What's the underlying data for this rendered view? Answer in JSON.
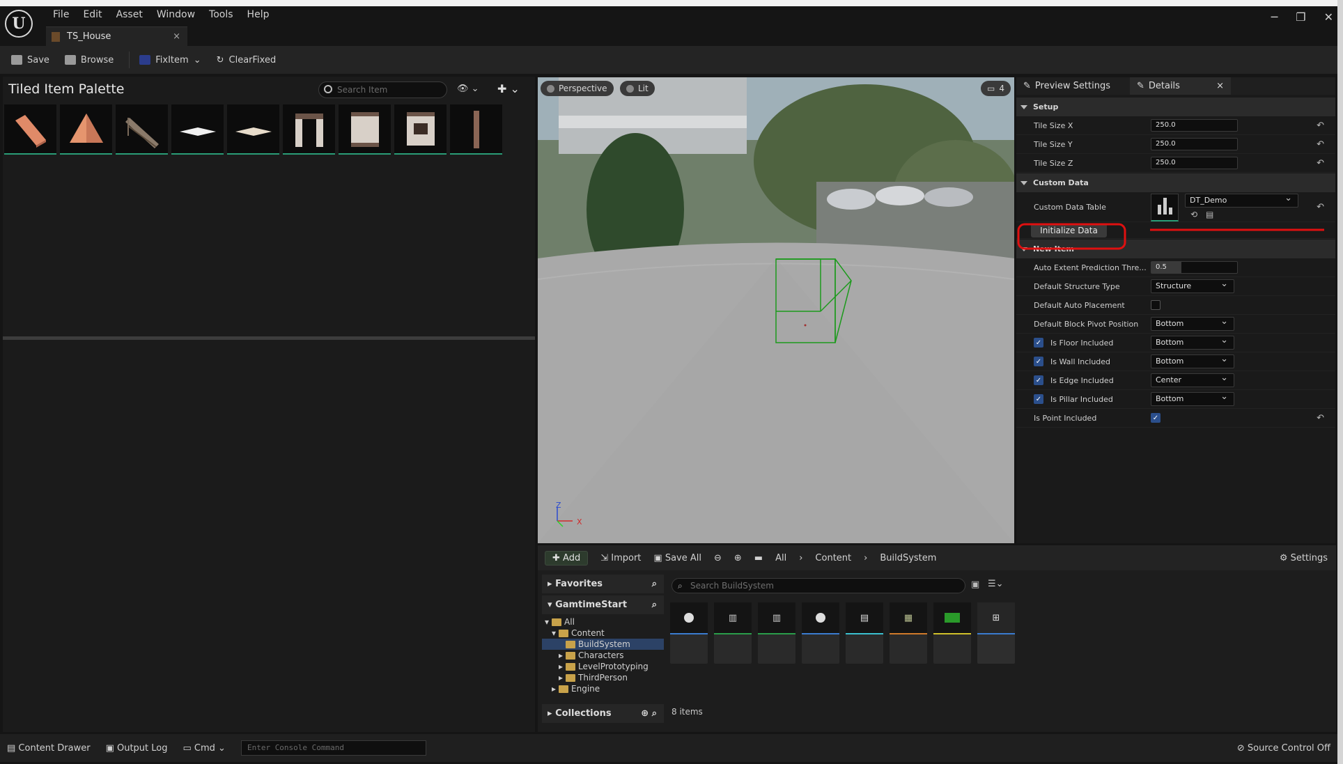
{
  "menu": [
    "File",
    "Edit",
    "Asset",
    "Window",
    "Tools",
    "Help"
  ],
  "document_tab": "TS_House",
  "toolbar": {
    "save": "Save",
    "browse": "Browse",
    "fixitem": "FixItem",
    "clearfixed": "ClearFixed"
  },
  "palette": {
    "title": "Tiled Item Palette",
    "search_placeholder": "Search Item"
  },
  "viewport": {
    "perspective": "Perspective",
    "lit": "Lit",
    "camera_speed": "4",
    "axis_x": "X",
    "axis_z": "Z"
  },
  "details": {
    "tabs": {
      "preview": "Preview Settings",
      "details": "Details"
    },
    "setup": {
      "header": "Setup",
      "tile_size_x_label": "Tile Size X",
      "tile_size_x": "250.0",
      "tile_size_y_label": "Tile Size Y",
      "tile_size_y": "250.0",
      "tile_size_z_label": "Tile Size Z",
      "tile_size_z": "250.0"
    },
    "custom_data": {
      "header": "Custom Data",
      "table_label": "Custom Data Table",
      "table_value": "DT_Demo",
      "initialize_button": "Initialize Data"
    },
    "new_item": {
      "header": "New Item",
      "auto_extent_label": "Auto Extent Prediction Thre...",
      "auto_extent_value": "0.5",
      "structure_type_label": "Default Structure Type",
      "structure_type_value": "Structure",
      "auto_placement_label": "Default Auto Placement",
      "pivot_label": "Default Block Pivot Position",
      "pivot_value": "Bottom",
      "floor_label": "Is Floor Included",
      "floor_value": "Bottom",
      "wall_label": "Is Wall Included",
      "wall_value": "Bottom",
      "edge_label": "Is Edge Included",
      "edge_value": "Center",
      "pillar_label": "Is Pillar Included",
      "pillar_value": "Bottom",
      "point_label": "Is Point Included"
    }
  },
  "content_browser": {
    "add": "Add",
    "import": "Import",
    "save_all": "Save All",
    "breadcrumb": [
      "All",
      "Content",
      "BuildSystem"
    ],
    "settings": "Settings",
    "favorites": "Favorites",
    "project": "GamtimeStart",
    "tree": [
      "All",
      "Content",
      "BuildSystem",
      "Characters",
      "LevelPrototyping",
      "ThirdPerson",
      "Engine"
    ],
    "collections": "Collections",
    "search_placeholder": "Search BuildSystem",
    "item_count": "8 items"
  },
  "status_bar": {
    "content_drawer": "Content Drawer",
    "output_log": "Output Log",
    "cmd": "Cmd",
    "console_placeholder": "Enter Console Command",
    "source_control": "Source Control Off"
  },
  "colors": {
    "accent_green": "#2a9d77",
    "highlight_red": "#e01010",
    "selection_blue": "#2b4f8c"
  }
}
